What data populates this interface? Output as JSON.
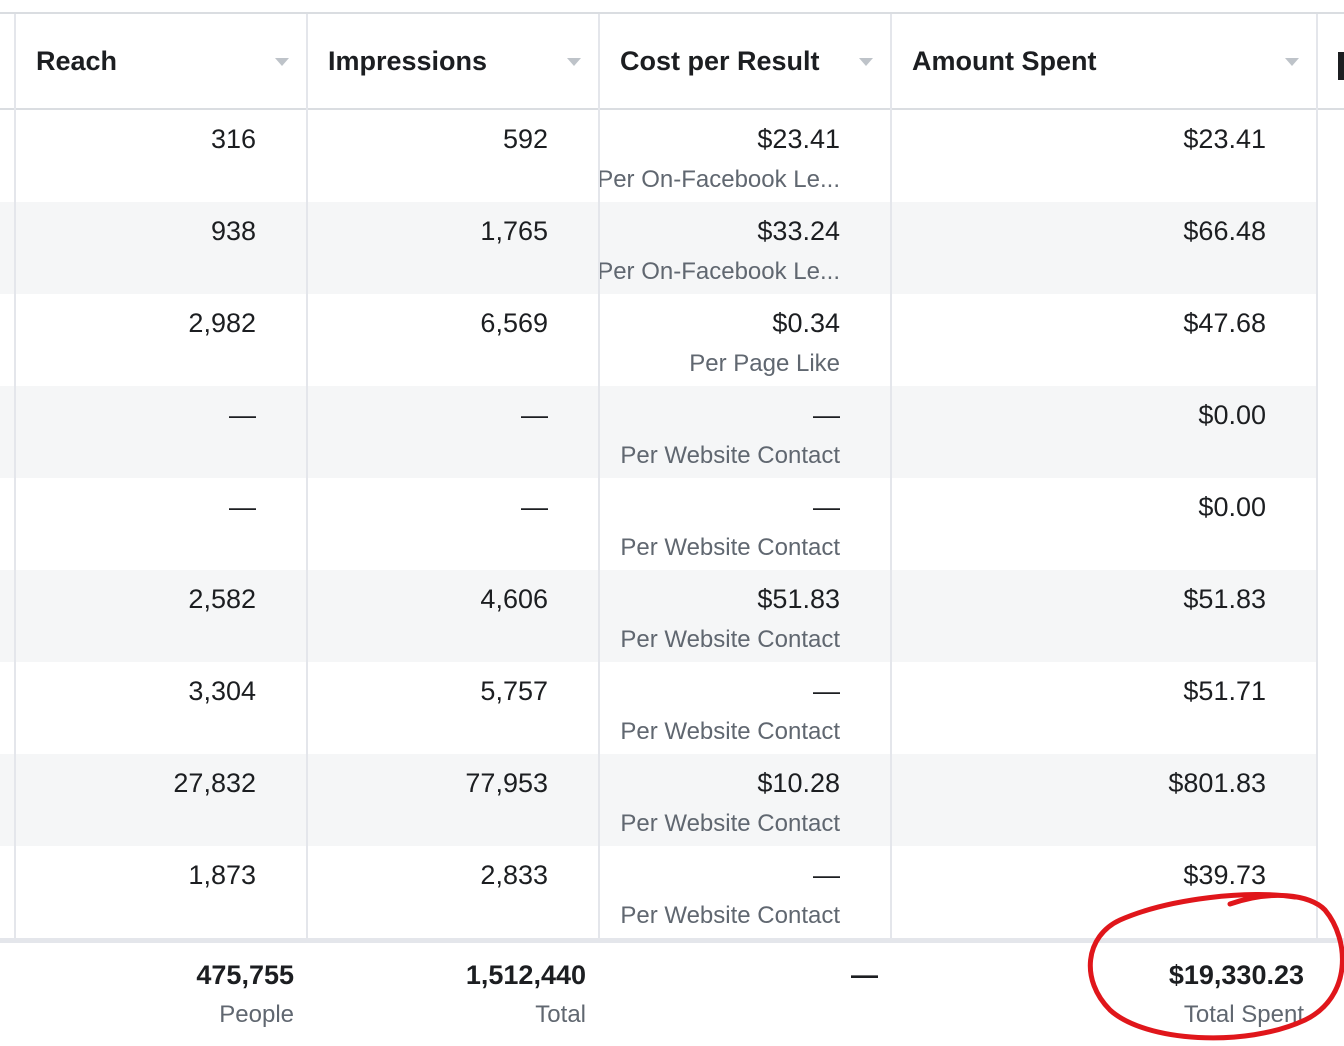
{
  "columns": [
    {
      "label": "Reach"
    },
    {
      "label": "Impressions"
    },
    {
      "label": "Cost per Result"
    },
    {
      "label": "Amount Spent"
    }
  ],
  "rows": [
    {
      "reach": "316",
      "impressions": "592",
      "cost": "$23.41",
      "cost_type": "Per On-Facebook Le...",
      "spent": "$23.41"
    },
    {
      "reach": "938",
      "impressions": "1,765",
      "cost": "$33.24",
      "cost_type": "Per On-Facebook Le...",
      "spent": "$66.48"
    },
    {
      "reach": "2,982",
      "impressions": "6,569",
      "cost": "$0.34",
      "cost_type": "Per Page Like",
      "spent": "$47.68"
    },
    {
      "reach": "—",
      "impressions": "—",
      "cost": "—",
      "cost_type": "Per Website Contact",
      "spent": "$0.00"
    },
    {
      "reach": "—",
      "impressions": "—",
      "cost": "—",
      "cost_type": "Per Website Contact",
      "spent": "$0.00"
    },
    {
      "reach": "2,582",
      "impressions": "4,606",
      "cost": "$51.83",
      "cost_type": "Per Website Contact",
      "spent": "$51.83"
    },
    {
      "reach": "3,304",
      "impressions": "5,757",
      "cost": "—",
      "cost_type": "Per Website Contact",
      "spent": "$51.71"
    },
    {
      "reach": "27,832",
      "impressions": "77,953",
      "cost": "$10.28",
      "cost_type": "Per Website Contact",
      "spent": "$801.83"
    },
    {
      "reach": "1,873",
      "impressions": "2,833",
      "cost": "—",
      "cost_type": "Per Website Contact",
      "spent": "$39.73"
    }
  ],
  "totals": {
    "reach": "475,755",
    "reach_label": "People",
    "impressions": "1,512,440",
    "impressions_label": "Total",
    "cost": "—",
    "spent": "$19,330.23",
    "spent_label": "Total Spent"
  },
  "annotation_color": "#e0161b"
}
